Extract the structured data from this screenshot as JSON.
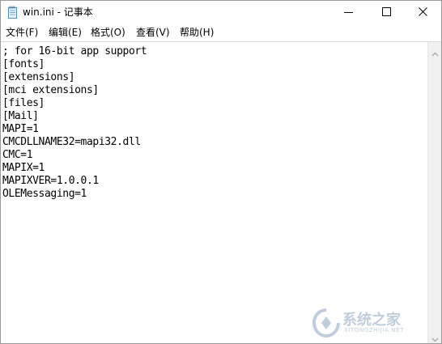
{
  "window": {
    "title": "win.ini - 记事本",
    "icons": {
      "app": "notepad-icon",
      "minimize": "minimize-icon",
      "maximize": "maximize-icon",
      "close": "close-icon"
    }
  },
  "menu": {
    "items": [
      {
        "label": "文件(F)"
      },
      {
        "label": "编辑(E)"
      },
      {
        "label": "格式(O)"
      },
      {
        "label": "查看(V)"
      },
      {
        "label": "帮助(H)"
      }
    ]
  },
  "editor": {
    "lines": [
      "; for 16-bit app support",
      "[fonts]",
      "[extensions]",
      "[mci extensions]",
      "[files]",
      "[Mail]",
      "MAPI=1",
      "CMCDLLNAME32=mapi32.dll",
      "CMC=1",
      "MAPIX=1",
      "MAPIXVER=1.0.0.1",
      "OLEMessaging=1"
    ]
  },
  "watermark": {
    "brand": "系统之家",
    "site": "XITONGZHIJIA.NET"
  },
  "colors": {
    "title_bar": "#ffffff",
    "scrollbar": "#f0f0f0",
    "window_border": "#9a9a9a"
  }
}
